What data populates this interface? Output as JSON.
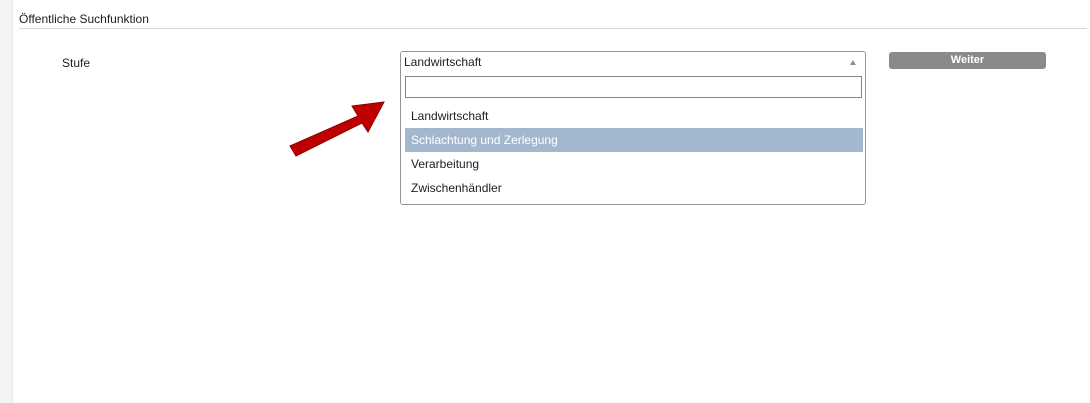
{
  "section": {
    "title": "Öffentliche Suchfunktion"
  },
  "form": {
    "stufe_label": "Stufe",
    "select": {
      "selected_value": "Landwirtschaft",
      "search_value": "",
      "options": [
        {
          "label": "Landwirtschaft",
          "highlighted": false
        },
        {
          "label": "Schlachtung und Zerlegung",
          "highlighted": true
        },
        {
          "label": "Verarbeitung",
          "highlighted": false
        },
        {
          "label": "Zwischenhändler",
          "highlighted": false
        }
      ]
    },
    "weiter_label": "Weiter"
  },
  "colors": {
    "highlight": "#a3b8cf",
    "button": "#8a8a8a",
    "annotation_arrow": "#c00000"
  },
  "icons": {
    "dropdown_arrow": "caret-up-icon",
    "annotation": "red-arrow-icon"
  }
}
